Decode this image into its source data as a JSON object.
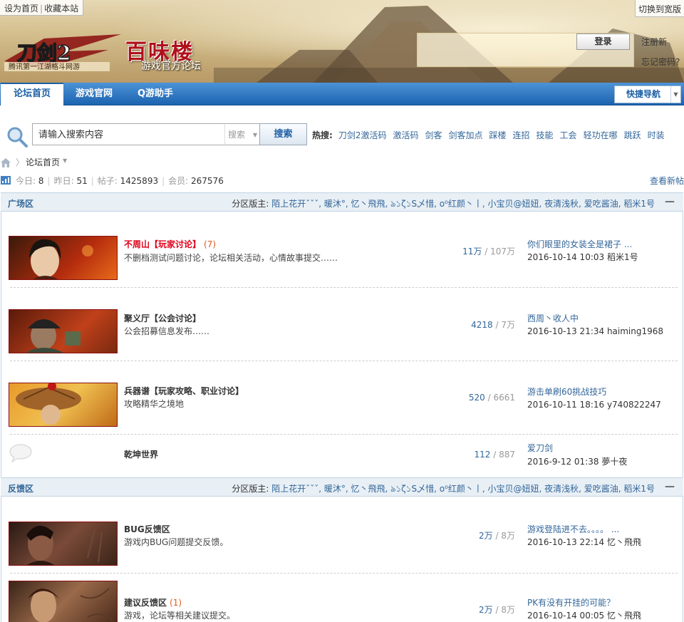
{
  "header": {
    "top_links": [
      "设为首页",
      "收藏本站"
    ],
    "switch_wide": "切换到宽版",
    "logo_game": "刀剑2",
    "logo_slogan": "腾讯第一江湖格斗网游",
    "logo_title": "百味楼",
    "logo_sub": "游戏官方论坛",
    "login_button": "登录",
    "register_link": "注册新",
    "forgot_link": "忘记密码?"
  },
  "nav": {
    "items": [
      "论坛首页",
      "游戏官网",
      "Q游助手"
    ],
    "active": "论坛首页",
    "quick_nav": "快捷导航"
  },
  "search": {
    "input_value": "请输入搜索内容",
    "type": "搜索",
    "button": "搜索",
    "hot_label": "热搜:",
    "hot_terms": [
      "刀剑2激活码",
      "激活码",
      "剑客",
      "剑客加点",
      "踩楼",
      "连招",
      "技能",
      "工会",
      "轻功在哪",
      "跳跃",
      "时装"
    ]
  },
  "breadcrumb": {
    "current": "论坛首页"
  },
  "stats": {
    "today_label": "今日:",
    "today": "8",
    "yesterday_label": "昨日:",
    "yesterday": "51",
    "posts_label": "帖子:",
    "posts": "1425893",
    "members_label": "会员:",
    "members": "267576",
    "new_posts_link": "查看新帖"
  },
  "sections": [
    {
      "title": "广场区",
      "mods_label": "分区版主:",
      "mods": "陌上花开ˇˇˇ, 暖沐°, 忆丶飛飛, ঌ১ζ১S乄惜, o⁰红颜丶丨, 小宝贝@妞妞, 夜清浅秋, 爱吃酱油, 稻米1号",
      "forums": [
        {
          "name": "不周山【玩家讨论】",
          "today_count": "(7)",
          "desc": "不删档测试问题讨论，论坛相关活动，心情故事提交……",
          "threads": "11万",
          "posts": "107万",
          "last_title": "你们眼里的女装全是裙子 ...",
          "last_meta": "2016-10-14 10:03 稻米1号"
        },
        {
          "name": "聚义厅【公会讨论】",
          "today_count": "",
          "desc": "公会招募信息发布……",
          "threads": "4218",
          "posts": "7万",
          "last_title": "西周丶收人中",
          "last_meta": "2016-10-13 21:34 haiming1968"
        },
        {
          "name": "兵器谱【玩家攻略、职业讨论】",
          "today_count": "",
          "desc": "攻略精华之境地",
          "threads": "520",
          "posts": "6661",
          "last_title": "游击单刷60挑战技巧",
          "last_meta": "2016-10-11 18:16 y740822247"
        },
        {
          "name": "乾坤世界",
          "today_count": "",
          "desc": "",
          "threads": "112",
          "posts": "887",
          "last_title": "爱刀剑",
          "last_meta": "2016-9-12 01:38 夢十夜"
        }
      ]
    },
    {
      "title": "反馈区",
      "mods_label": "分区版主:",
      "mods": "陌上花开ˇˇˇ, 暖沐°, 忆丶飛飛, ঌ১ζ১S乄惜, o⁰红颜丶丨, 小宝贝@妞妞, 夜清浅秋, 爱吃酱油, 稻米1号",
      "forums": [
        {
          "name": "BUG反馈区",
          "today_count": "",
          "desc": "游戏内BUG问题提交反馈。",
          "threads": "2万",
          "posts": "8万",
          "last_title": "游戏登陆进不去。。。。 ...",
          "last_meta": "2016-10-13 22:14 忆丶飛飛"
        },
        {
          "name": "建议反馈区",
          "today_count": "(1)",
          "desc": "游戏，论坛等相关建议提交。",
          "threads": "2万",
          "posts": "8万",
          "last_title": "PK有没有开挂的可能？",
          "last_meta": "2016-10-14 00:05 忆丶飛飛"
        }
      ]
    }
  ],
  "colors": {
    "nav_blue": "#1c63b0",
    "link": "#336699",
    "hot_red": "#e0001a",
    "section_bg": "#e8eff5"
  }
}
